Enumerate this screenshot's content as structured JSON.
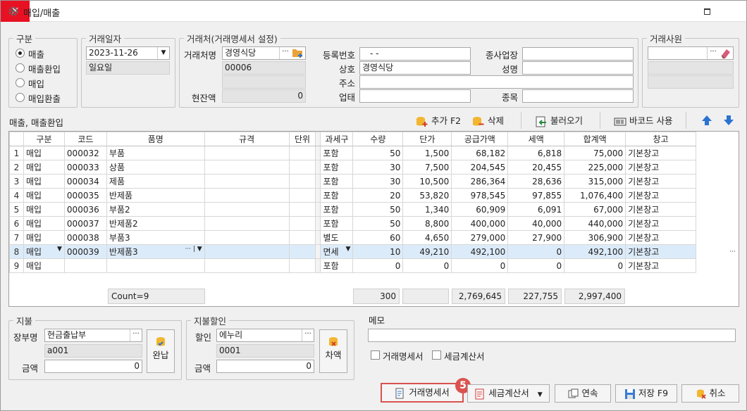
{
  "window": {
    "title": "매입/매출",
    "minimize": "▫",
    "close": "✕"
  },
  "gubun": {
    "legend": "구분",
    "options": [
      {
        "label": "매출",
        "selected": true
      },
      {
        "label": "매출환입",
        "selected": false
      },
      {
        "label": "매입",
        "selected": false
      },
      {
        "label": "매입환출",
        "selected": false
      }
    ]
  },
  "trade_date": {
    "legend": "거래일자",
    "date": "2023-11-26",
    "weekday": "일요일"
  },
  "partner": {
    "legend": "거래처(거래명세서 설정)",
    "name_label": "거래처명",
    "name": "경영식당",
    "code": "00006",
    "extra": "",
    "balance_label": "현잔액",
    "balance": "0",
    "reg_label": "등록번호",
    "reg": " -  - ",
    "company_label": "상호",
    "company": "경영식당",
    "addr_label": "주소",
    "addr": "",
    "biz_label": "업태",
    "biz": "",
    "type_label": "종사업장",
    "type": "",
    "ceo_label": "성명",
    "ceo": "",
    "item_label": "종목",
    "item": ""
  },
  "staff": {
    "legend": "거래사원",
    "name": "",
    "v1": "",
    "v2": ""
  },
  "toolbar": {
    "section_label": "매출, 매출환입",
    "add": "추가 F2",
    "delete": "삭제",
    "load": "불러오기",
    "barcode": "바코드 사용"
  },
  "grid": {
    "columns": [
      "구분",
      "코드",
      "품명",
      "규격",
      "단위",
      "과세구",
      "수량",
      "단가",
      "공급가액",
      "세액",
      "합계액",
      "창고"
    ],
    "rows": [
      {
        "n": "1",
        "gubun": "매입",
        "code": "000032",
        "name": "부품",
        "spec": "",
        "unit": "",
        "tax": "포함",
        "qty": "50",
        "price": "1,500",
        "supply": "68,182",
        "vat": "6,818",
        "total": "75,000",
        "wh": "기본창고"
      },
      {
        "n": "2",
        "gubun": "매입",
        "code": "000033",
        "name": "상품",
        "spec": "",
        "unit": "",
        "tax": "포함",
        "qty": "30",
        "price": "7,500",
        "supply": "204,545",
        "vat": "20,455",
        "total": "225,000",
        "wh": "기본창고"
      },
      {
        "n": "3",
        "gubun": "매입",
        "code": "000034",
        "name": "제품",
        "spec": "",
        "unit": "",
        "tax": "포함",
        "qty": "30",
        "price": "10,500",
        "supply": "286,364",
        "vat": "28,636",
        "total": "315,000",
        "wh": "기본창고"
      },
      {
        "n": "4",
        "gubun": "매입",
        "code": "000035",
        "name": "반제품",
        "spec": "",
        "unit": "",
        "tax": "포함",
        "qty": "20",
        "price": "53,820",
        "supply": "978,545",
        "vat": "97,855",
        "total": "1,076,400",
        "wh": "기본창고"
      },
      {
        "n": "5",
        "gubun": "매입",
        "code": "000036",
        "name": "부품2",
        "spec": "",
        "unit": "",
        "tax": "포함",
        "qty": "50",
        "price": "1,340",
        "supply": "60,909",
        "vat": "6,091",
        "total": "67,000",
        "wh": "기본창고"
      },
      {
        "n": "6",
        "gubun": "매입",
        "code": "000037",
        "name": "반제품2",
        "spec": "",
        "unit": "",
        "tax": "포함",
        "qty": "50",
        "price": "8,800",
        "supply": "400,000",
        "vat": "40,000",
        "total": "440,000",
        "wh": "기본창고"
      },
      {
        "n": "7",
        "gubun": "매입",
        "code": "000038",
        "name": "부품3",
        "spec": "",
        "unit": "",
        "tax": "별도",
        "qty": "60",
        "price": "4,650",
        "supply": "279,000",
        "vat": "27,900",
        "total": "306,900",
        "wh": "기본창고"
      },
      {
        "n": "8",
        "gubun": "매입",
        "code": "000039",
        "name": "반제품3",
        "spec": "",
        "unit": "",
        "tax": "면세",
        "qty": "10",
        "price": "49,210",
        "supply": "492,100",
        "vat": "0",
        "total": "492,100",
        "wh": "기본창고"
      },
      {
        "n": "9",
        "gubun": "매입",
        "code": "",
        "name": "",
        "spec": "",
        "unit": "",
        "tax": "포함",
        "qty": "0",
        "price": "0",
        "supply": "0",
        "vat": "0",
        "total": "0",
        "wh": "기본창고"
      }
    ],
    "footer": {
      "count": "Count=9",
      "qty": "300",
      "supply": "2,769,645",
      "vat": "227,755",
      "total": "2,997,400"
    }
  },
  "payment": {
    "legend": "지불",
    "book_label": "장부명",
    "book": "현금출납부",
    "code": "a001",
    "amount_label": "금액",
    "amount": "0",
    "button": "완납"
  },
  "discount": {
    "legend": "지불할인",
    "label": "할인",
    "name": "에누리",
    "code": "0001",
    "amount_label": "금액",
    "amount": "0",
    "button": "차액"
  },
  "memo": {
    "label": "메모",
    "value": "",
    "chk1": "거래명세서",
    "chk2": "세금계산서"
  },
  "bottom": {
    "badge": "5",
    "statement": "거래명세서",
    "tax_invoice": "세금계산서",
    "continuous": "연속",
    "save": "저장 F9",
    "cancel": "취소"
  }
}
